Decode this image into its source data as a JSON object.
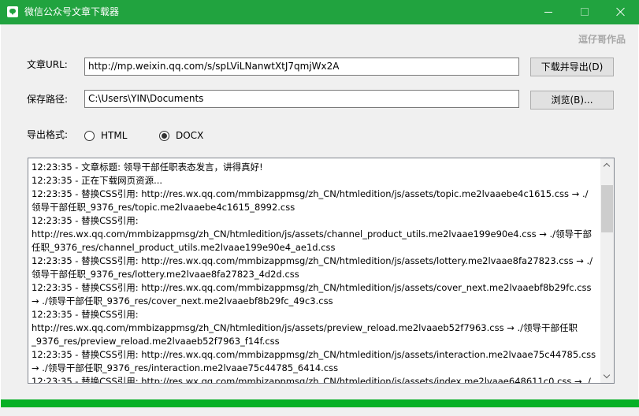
{
  "window": {
    "title": "微信公众号文章下载器",
    "icon": "wechat-icon",
    "accent_color": "#21a33f"
  },
  "header": {
    "author": "逗仔哥作品"
  },
  "form": {
    "url_label": "文章URL:",
    "url_value": "http://mp.weixin.qq.com/s/spLViLNanwtXtJ7qmjWx2A",
    "download_button": "下载并导出(D)",
    "path_label": "保存路径:",
    "path_value": "C:\\Users\\YIN\\Documents",
    "browse_button": "浏览(B)...",
    "format_label": "导出格式:",
    "formats": [
      {
        "label": "HTML",
        "checked": false
      },
      {
        "label": "DOCX",
        "checked": true
      }
    ]
  },
  "log": {
    "lines": [
      "12:23:35 - 文章标题: 领导干部任职表态发言，讲得真好!",
      "12:23:35 - 正在下载网页资源...",
      "12:23:35 - 替换CSS引用: http://res.wx.qq.com/mmbizappmsg/zh_CN/htmledition/js/assets/topic.me2lvaaebe4c1615.css → ./",
      "领导干部任职_9376_res/topic.me2lvaaebe4c1615_8992.css",
      "12:23:35 - 替换CSS引用:",
      "http://res.wx.qq.com/mmbizappmsg/zh_CN/htmledition/js/assets/channel_product_utils.me2lvaae199e90e4.css → ./领导干部",
      "任职_9376_res/channel_product_utils.me2lvaae199e90e4_ae1d.css",
      "12:23:35 - 替换CSS引用: http://res.wx.qq.com/mmbizappmsg/zh_CN/htmledition/js/assets/lottery.me2lvaae8fa27823.css → ./",
      "领导干部任职_9376_res/lottery.me2lvaae8fa27823_4d2d.css",
      "12:23:35 - 替换CSS引用: http://res.wx.qq.com/mmbizappmsg/zh_CN/htmledition/js/assets/cover_next.me2lvaaebf8b29fc.css",
      "→ ./领导干部任职_9376_res/cover_next.me2lvaaebf8b29fc_49c3.css",
      "12:23:35 - 替换CSS引用:",
      "http://res.wx.qq.com/mmbizappmsg/zh_CN/htmledition/js/assets/preview_reload.me2lvaaeb52f7963.css → ./领导干部任职",
      "_9376_res/preview_reload.me2lvaaeb52f7963_f14f.css",
      "12:23:35 - 替换CSS引用: http://res.wx.qq.com/mmbizappmsg/zh_CN/htmledition/js/assets/interaction.me2lvaae75c44785.css",
      "→ ./领导干部任职_9376_res/interaction.me2lvaae75c44785_6414.css",
      "12:23:35 - 替换CSS引用: http://res.wx.qq.com/mmbizappmsg/zh_CN/htmledition/js/assets/index.me2lvaae648611c0.css → ./"
    ]
  },
  "progress": {
    "value_percent": 100,
    "color": "#06b025"
  }
}
